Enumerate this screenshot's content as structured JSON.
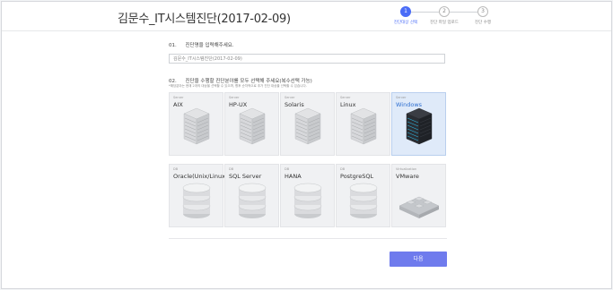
{
  "header": {
    "title": "김문수_IT시스템진단(2017-02-09)"
  },
  "steps": [
    {
      "num": "1",
      "label": "진단대상 선택",
      "active": true
    },
    {
      "num": "2",
      "label": "진단 파일 업로드",
      "active": false
    },
    {
      "num": "3",
      "label": "진단 수행",
      "active": false
    }
  ],
  "q1": {
    "num": "01.",
    "text": "진단명을 입력해주세요.",
    "input_value": "김문수_IT시스템진단(2017-02-09)"
  },
  "q2": {
    "num": "02.",
    "text": "진단을 수행할 진단분야를 모두 선택해 주세요(복수선택 가능)",
    "hint": "*해당분야는 현재 2개의 대상을 선택할 수 있으며, 향후 순차적으로 추가 진단 대상을 선택할 수 있습니다."
  },
  "targets_row1": [
    {
      "category": "Server",
      "name": "AIX",
      "icon": "server-icon",
      "selected": false
    },
    {
      "category": "Server",
      "name": "HP-UX",
      "icon": "server-icon",
      "selected": false
    },
    {
      "category": "Server",
      "name": "Solaris",
      "icon": "server-icon",
      "selected": false
    },
    {
      "category": "Server",
      "name": "Linux",
      "icon": "server-icon",
      "selected": false
    },
    {
      "category": "Server",
      "name": "Windows",
      "icon": "server-dark-icon",
      "selected": true
    }
  ],
  "targets_row2": [
    {
      "category": "DB",
      "name": "Oracle(Unix/Linux)",
      "icon": "database-icon",
      "selected": false
    },
    {
      "category": "DB",
      "name": "SQL Server",
      "icon": "database-icon",
      "selected": false
    },
    {
      "category": "DB",
      "name": "HANA",
      "icon": "database-icon",
      "selected": false
    },
    {
      "category": "DB",
      "name": "PostgreSQL",
      "icon": "database-icon",
      "selected": false
    },
    {
      "category": "Virtualization",
      "name": "VMware",
      "icon": "virtualization-icon",
      "selected": false
    }
  ],
  "next_button": {
    "label": "다음"
  },
  "colors": {
    "accent": "#4a6cf7",
    "button": "#6f7bed",
    "selected_card": "#dfeaf9",
    "selected_text": "#2f6fd0"
  }
}
